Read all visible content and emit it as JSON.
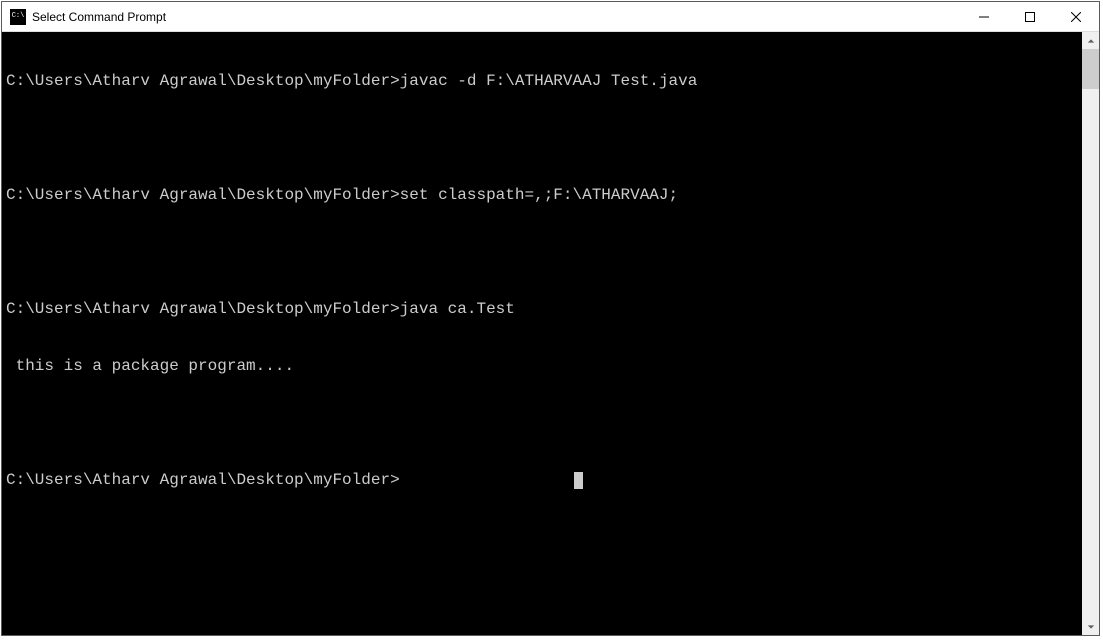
{
  "window": {
    "title": "Select Command Prompt"
  },
  "terminal": {
    "prompt": "C:\\Users\\Atharv Agrawal\\Desktop\\myFolder>",
    "entries": [
      {
        "type": "cmd",
        "text": "C:\\Users\\Atharv Agrawal\\Desktop\\myFolder>javac -d F:\\ATHARVAAJ Test.java"
      },
      {
        "type": "blank",
        "text": ""
      },
      {
        "type": "cmd",
        "text": "C:\\Users\\Atharv Agrawal\\Desktop\\myFolder>set classpath=,;F:\\ATHARVAAJ;"
      },
      {
        "type": "blank",
        "text": ""
      },
      {
        "type": "cmd",
        "text": "C:\\Users\\Atharv Agrawal\\Desktop\\myFolder>java ca.Test"
      },
      {
        "type": "output",
        "text": " this is a package program...."
      },
      {
        "type": "blank",
        "text": ""
      },
      {
        "type": "prompt",
        "text": "C:\\Users\\Atharv Agrawal\\Desktop\\myFolder>"
      }
    ],
    "cursor_offset_spaces": "                  "
  }
}
